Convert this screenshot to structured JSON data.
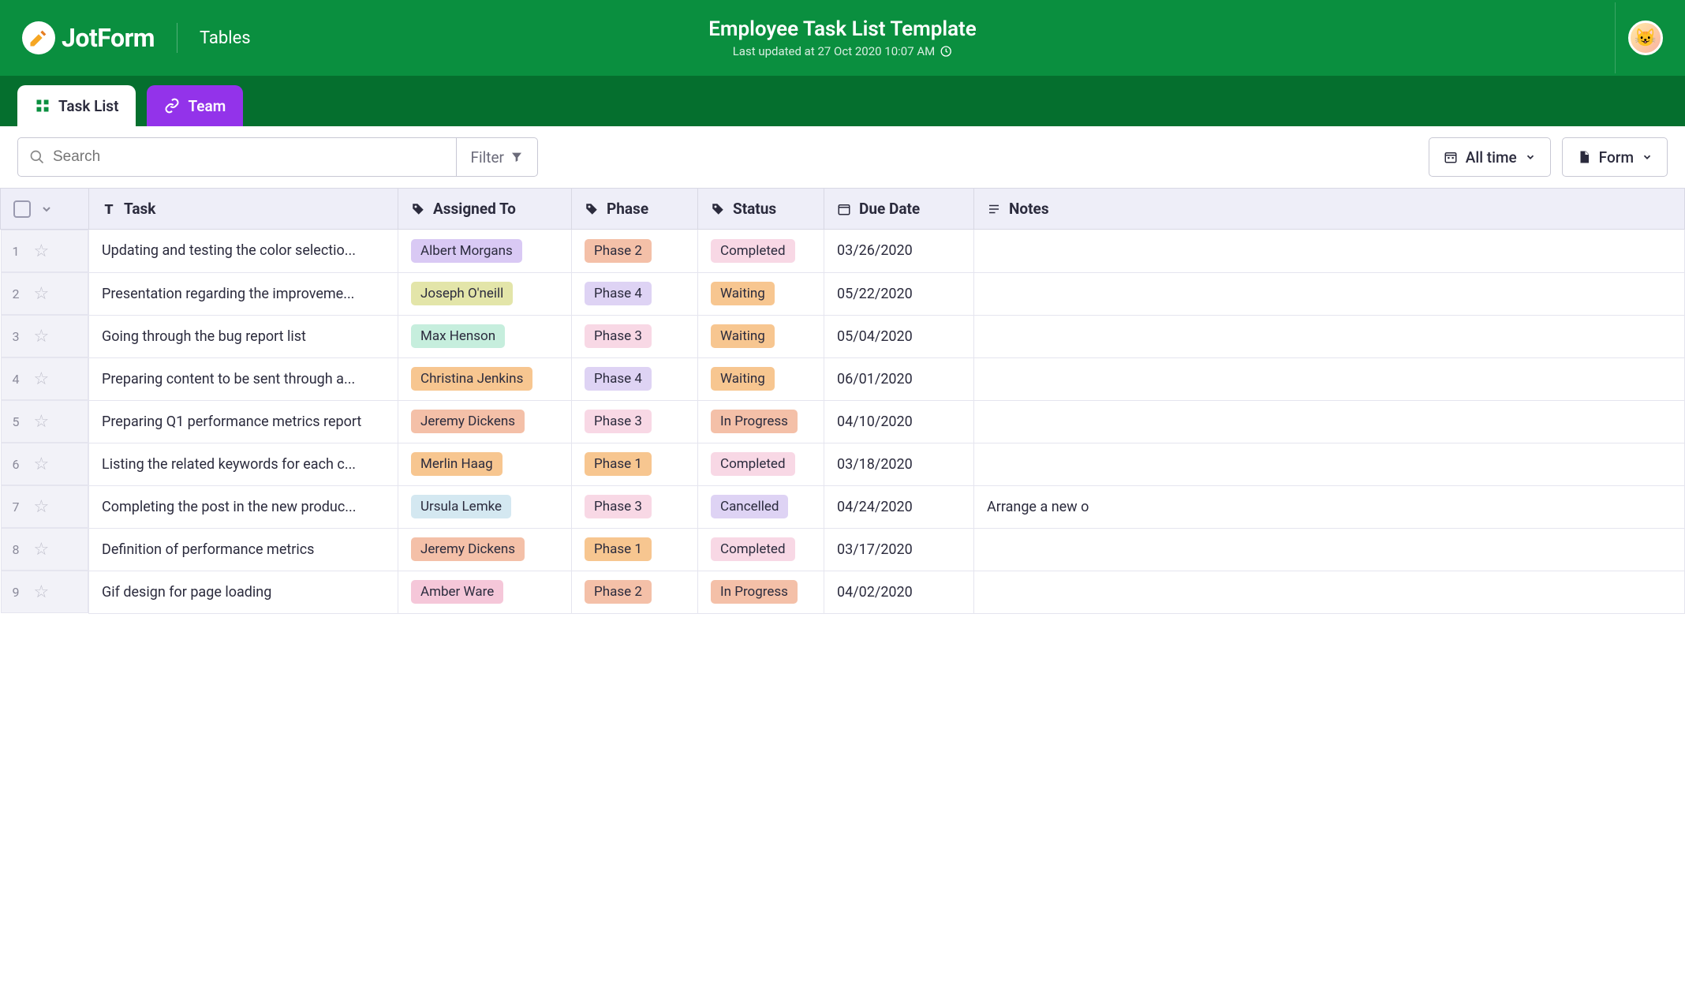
{
  "brand": {
    "name": "JotForm",
    "subproduct": "Tables"
  },
  "page": {
    "title": "Employee Task List Template",
    "last_updated": "Last updated at 27 Oct 2020 10:07 AM"
  },
  "tabs": [
    {
      "label": "Task List",
      "active": true,
      "icon": "grid-icon"
    },
    {
      "label": "Team",
      "active": false,
      "icon": "link-icon"
    }
  ],
  "toolbar": {
    "search_placeholder": "Search",
    "filter_label": "Filter",
    "time_filter": "All time",
    "form_button": "Form"
  },
  "columns": [
    {
      "label": "Task",
      "icon": "text-icon"
    },
    {
      "label": "Assigned To",
      "icon": "tag-icon"
    },
    {
      "label": "Phase",
      "icon": "tag-icon"
    },
    {
      "label": "Status",
      "icon": "tag-icon"
    },
    {
      "label": "Due Date",
      "icon": "calendar-icon"
    },
    {
      "label": "Notes",
      "icon": "notes-icon"
    }
  ],
  "assignee_colors": {
    "Albert Morgans": "c-lavender",
    "Joseph O'neill": "c-olive",
    "Max Henson": "c-mint",
    "Christina Jenkins": "c-orange",
    "Jeremy Dickens": "c-peach",
    "Merlin Haag": "c-orange",
    "Ursula Lemke": "c-ltblue",
    "Amber Ware": "c-pink"
  },
  "phase_colors": {
    "Phase 1": "c-orange",
    "Phase 2": "c-peach",
    "Phase 3": "c-ltpink",
    "Phase 4": "c-lav2"
  },
  "status_colors": {
    "Completed": "c-ltpink",
    "Waiting": "c-orange",
    "In Progress": "c-peach",
    "Cancelled": "c-lav2"
  },
  "rows": [
    {
      "task": "Updating and testing the color selectio...",
      "assigned": "Albert Morgans",
      "phase": "Phase 2",
      "status": "Completed",
      "due": "03/26/2020",
      "notes": ""
    },
    {
      "task": "Presentation regarding the improveme...",
      "assigned": "Joseph O'neill",
      "phase": "Phase 4",
      "status": "Waiting",
      "due": "05/22/2020",
      "notes": ""
    },
    {
      "task": "Going through the bug report list",
      "assigned": "Max Henson",
      "phase": "Phase 3",
      "status": "Waiting",
      "due": "05/04/2020",
      "notes": ""
    },
    {
      "task": "Preparing content to be sent through a...",
      "assigned": "Christina Jenkins",
      "phase": "Phase 4",
      "status": "Waiting",
      "due": "06/01/2020",
      "notes": ""
    },
    {
      "task": "Preparing Q1 performance metrics report",
      "assigned": "Jeremy Dickens",
      "phase": "Phase 3",
      "status": "In Progress",
      "due": "04/10/2020",
      "notes": ""
    },
    {
      "task": "Listing the related keywords for each c...",
      "assigned": "Merlin Haag",
      "phase": "Phase 1",
      "status": "Completed",
      "due": "03/18/2020",
      "notes": ""
    },
    {
      "task": "Completing the post in the new produc...",
      "assigned": "Ursula Lemke",
      "phase": "Phase 3",
      "status": "Cancelled",
      "due": "04/24/2020",
      "notes": "Arrange a new o"
    },
    {
      "task": "Definition of performance metrics",
      "assigned": "Jeremy Dickens",
      "phase": "Phase 1",
      "status": "Completed",
      "due": "03/17/2020",
      "notes": ""
    },
    {
      "task": "Gif design for page loading",
      "assigned": "Amber Ware",
      "phase": "Phase 2",
      "status": "In Progress",
      "due": "04/02/2020",
      "notes": ""
    }
  ]
}
